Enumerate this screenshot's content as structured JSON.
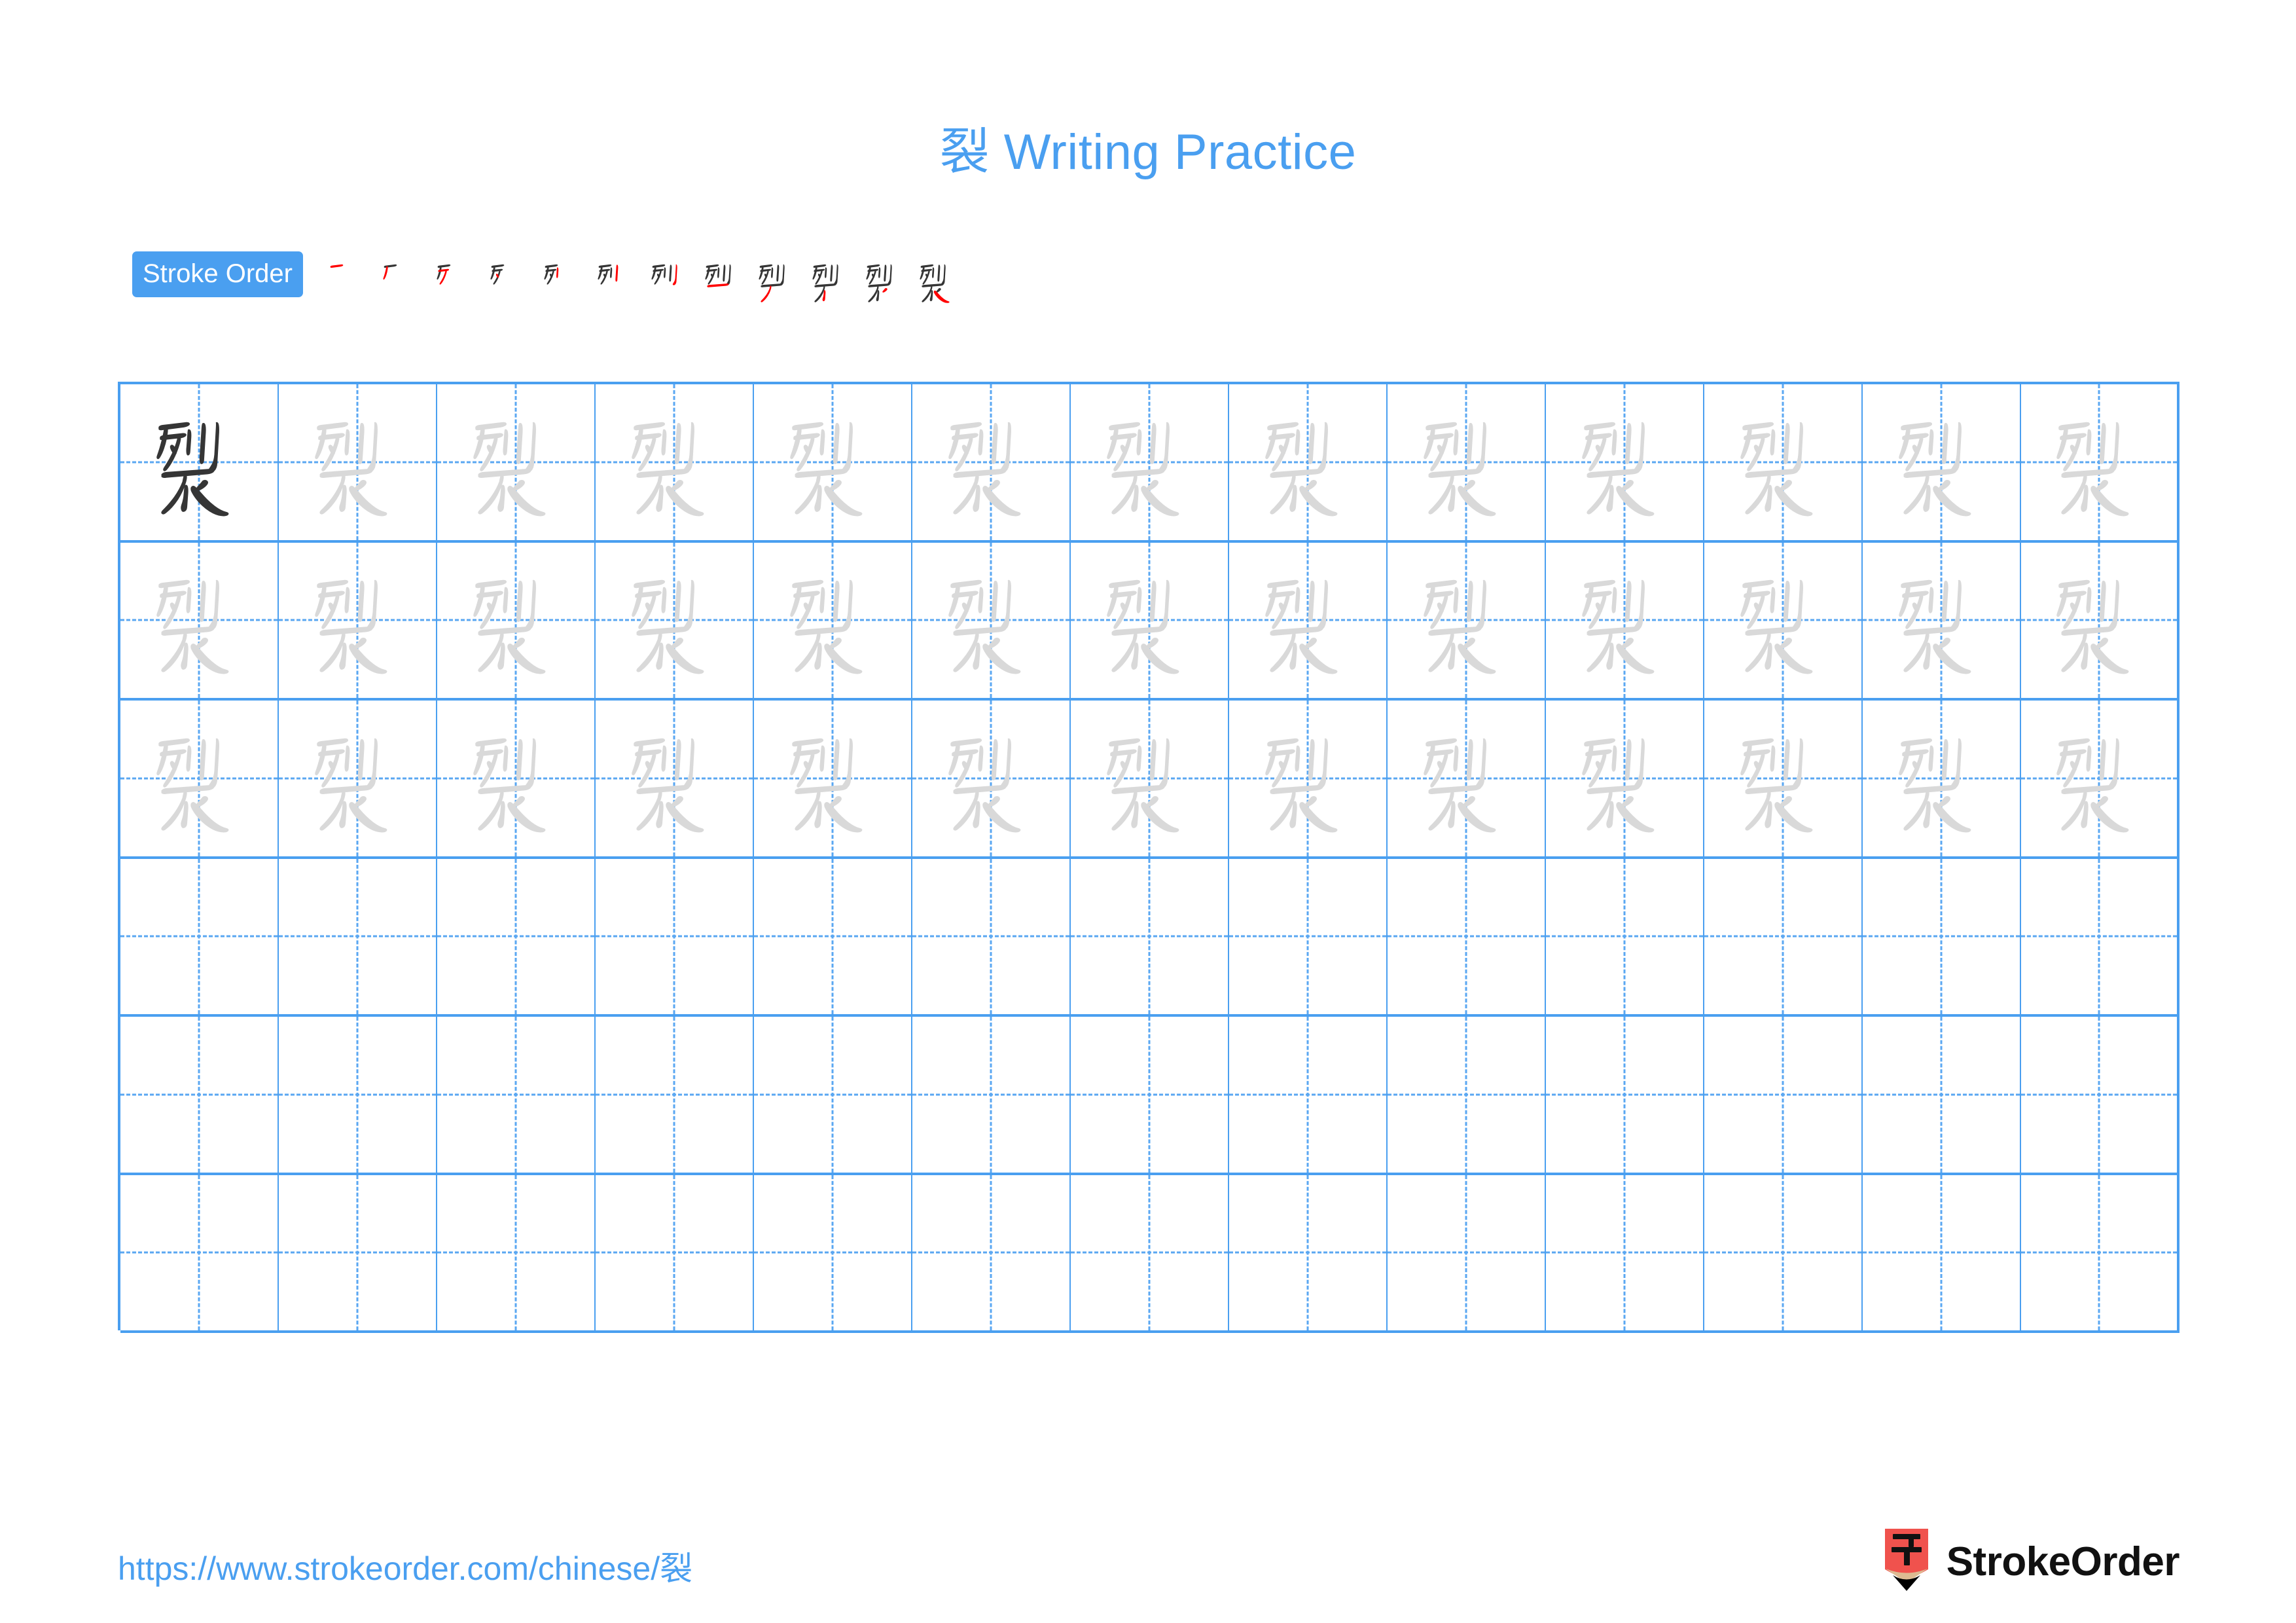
{
  "page": {
    "character": "裂",
    "title": "裂 Writing Practice",
    "title_character": "裂",
    "title_text": "Writing Practice",
    "background_color": "#FFFFFF"
  },
  "stroke_order": {
    "badge_label": "Stroke Order",
    "badge_bg_color": "#4A9FF0",
    "badge_text_color": "#FFFFFF",
    "total_strokes": 12,
    "completed_stroke_color": "#353535",
    "new_stroke_color": "#FF0000",
    "steps": [
      {
        "index": 1,
        "name": "stroke-step-1",
        "strokes_shown": 1,
        "new_stroke": 1
      },
      {
        "index": 2,
        "name": "stroke-step-2",
        "strokes_shown": 2,
        "new_stroke": 2
      },
      {
        "index": 3,
        "name": "stroke-step-3",
        "strokes_shown": 3,
        "new_stroke": 3
      },
      {
        "index": 4,
        "name": "stroke-step-4",
        "strokes_shown": 4,
        "new_stroke": 4
      },
      {
        "index": 5,
        "name": "stroke-step-5",
        "strokes_shown": 5,
        "new_stroke": 5
      },
      {
        "index": 6,
        "name": "stroke-step-6",
        "strokes_shown": 6,
        "new_stroke": 6
      },
      {
        "index": 7,
        "name": "stroke-step-7",
        "strokes_shown": 7,
        "new_stroke": 7
      },
      {
        "index": 8,
        "name": "stroke-step-8",
        "strokes_shown": 8,
        "new_stroke": 8
      },
      {
        "index": 9,
        "name": "stroke-step-9",
        "strokes_shown": 9,
        "new_stroke": 9
      },
      {
        "index": 10,
        "name": "stroke-step-10",
        "strokes_shown": 10,
        "new_stroke": 10
      },
      {
        "index": 11,
        "name": "stroke-step-11",
        "strokes_shown": 11,
        "new_stroke": 11
      },
      {
        "index": 12,
        "name": "stroke-step-12",
        "strokes_shown": 12,
        "new_stroke": 12
      }
    ]
  },
  "practice_grid": {
    "columns": 13,
    "rows": 6,
    "grid_line_color": "#4A9FF0",
    "guide_line_color": "#5AA7F2",
    "dark_glyph_color": "#353535",
    "trace_glyph_color": "#D9D9D9",
    "row_contents": [
      {
        "row": 1,
        "cells": [
          "dark",
          "trace",
          "trace",
          "trace",
          "trace",
          "trace",
          "trace",
          "trace",
          "trace",
          "trace",
          "trace",
          "trace",
          "trace"
        ]
      },
      {
        "row": 2,
        "cells": [
          "trace",
          "trace",
          "trace",
          "trace",
          "trace",
          "trace",
          "trace",
          "trace",
          "trace",
          "trace",
          "trace",
          "trace",
          "trace"
        ]
      },
      {
        "row": 3,
        "cells": [
          "trace",
          "trace",
          "trace",
          "trace",
          "trace",
          "trace",
          "trace",
          "trace",
          "trace",
          "trace",
          "trace",
          "trace",
          "trace"
        ]
      },
      {
        "row": 4,
        "cells": [
          "empty",
          "empty",
          "empty",
          "empty",
          "empty",
          "empty",
          "empty",
          "empty",
          "empty",
          "empty",
          "empty",
          "empty",
          "empty"
        ]
      },
      {
        "row": 5,
        "cells": [
          "empty",
          "empty",
          "empty",
          "empty",
          "empty",
          "empty",
          "empty",
          "empty",
          "empty",
          "empty",
          "empty",
          "empty",
          "empty"
        ]
      },
      {
        "row": 6,
        "cells": [
          "empty",
          "empty",
          "empty",
          "empty",
          "empty",
          "empty",
          "empty",
          "empty",
          "empty",
          "empty",
          "empty",
          "empty",
          "empty"
        ]
      }
    ]
  },
  "footer": {
    "url": "https://www.strokeorder.com/chinese/裂",
    "url_color": "#4A9FF0",
    "brand_name": "StrokeOrder",
    "brand_text_color": "#111111",
    "logo_icon": "pencil-zi-icon",
    "logo_body_color": "#F0524D",
    "logo_wood_color": "#DDBB92",
    "logo_tip_color": "#000000",
    "logo_character": "字"
  }
}
